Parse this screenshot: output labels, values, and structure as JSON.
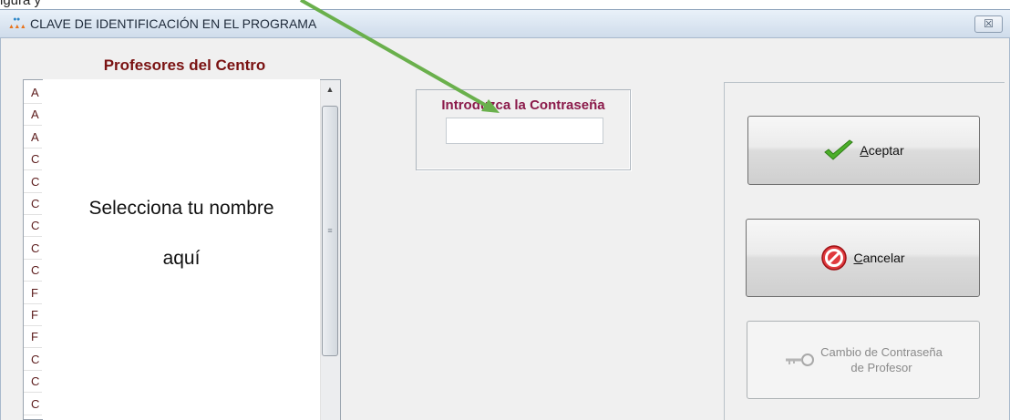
{
  "window": {
    "title": "CLAVE DE IDENTIFICACIÓN EN EL PROGRAMA",
    "close_glyph": "☒",
    "top_fragment": "igura y"
  },
  "teachers_list": {
    "heading": "Profesores del Centro",
    "row_initials": [
      "A",
      "A",
      "A",
      "C",
      "C",
      "C",
      "C",
      "C",
      "C",
      "F",
      "F",
      "F",
      "C",
      "C",
      "C"
    ]
  },
  "overlay": {
    "line1": "Selecciona tu nombre",
    "line2": "aquí"
  },
  "password": {
    "label": "Introduzca la Contraseña",
    "value": ""
  },
  "buttons": {
    "accept_mnemonic": "A",
    "accept_rest": "ceptar",
    "cancel_mnemonic": "C",
    "cancel_rest": "ancelar",
    "change_line1": "Cambio de Contraseña",
    "change_line2": "de Profesor"
  },
  "colors": {
    "heading": "#7a1212",
    "password_label": "#8b1a4a",
    "arrow": "#6ab04c",
    "accept_check": "#4caf2a",
    "cancel_icon": "#d8262c"
  },
  "icons": {
    "app": "app-logo-icon",
    "close": "close-icon",
    "accept": "checkmark-icon",
    "cancel": "no-entry-icon",
    "change": "key-icon"
  }
}
